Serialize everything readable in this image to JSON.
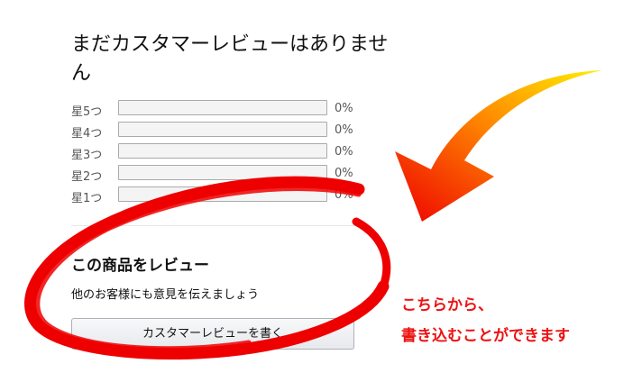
{
  "reviews": {
    "title": "まだカスタマーレビューはありません",
    "ratings": [
      {
        "label": "星5つ",
        "percent": "0%",
        "fraction": 0
      },
      {
        "label": "星4つ",
        "percent": "0%",
        "fraction": 0
      },
      {
        "label": "星3つ",
        "percent": "0%",
        "fraction": 0
      },
      {
        "label": "星2つ",
        "percent": "0%",
        "fraction": 0
      },
      {
        "label": "星1つ",
        "percent": "0%",
        "fraction": 0
      }
    ],
    "write_heading": "この商品をレビュー",
    "write_subtext": "他のお客様にも意見を伝えましょう",
    "write_button": "カスタマーレビューを書く"
  },
  "annotation": {
    "line1": "こちらから、",
    "line2": "書き込むことができます",
    "color": "#ee1111",
    "arrow_colors": [
      "#ffee00",
      "#ff8800",
      "#ee0000"
    ]
  }
}
